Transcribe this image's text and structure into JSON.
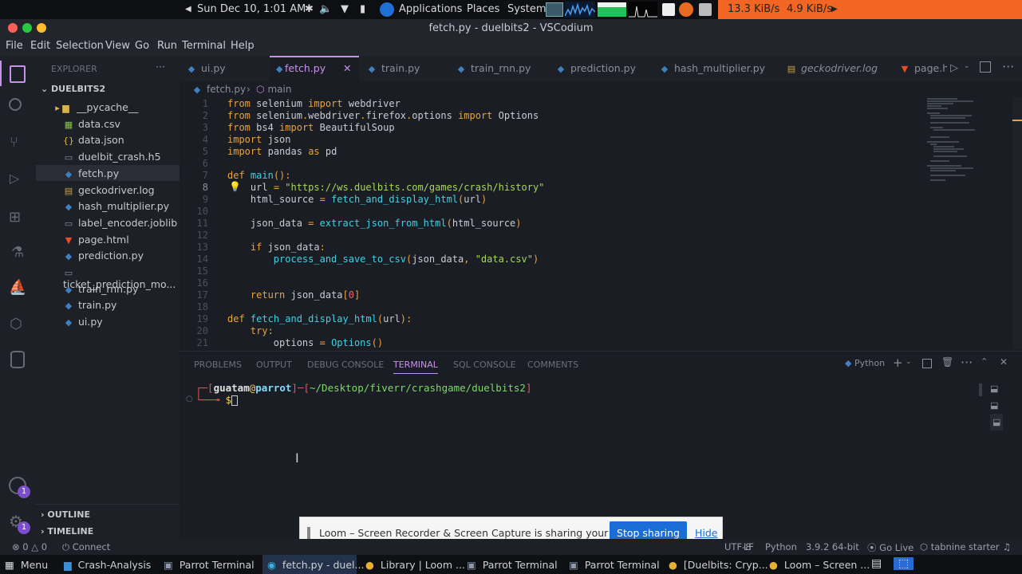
{
  "topbar": {
    "datetime": "Sun Dec 10,  1:01 AM",
    "applications": "Applications",
    "places": "Places",
    "system": "System",
    "net_down": "13.3 KiB/s",
    "net_up": "4.9 KiB/s"
  },
  "window_title": "fetch.py - duelbits2 - VSCodium",
  "menu": [
    "File",
    "Edit",
    "Selection",
    "View",
    "Go",
    "Run",
    "Terminal",
    "Help"
  ],
  "sidebar": {
    "header": "EXPLORER",
    "folder": "DUELBITS2",
    "files": [
      {
        "name": "__pycache__",
        "icon": "folder-icon",
        "color": "#d8b24c"
      },
      {
        "name": "data.csv",
        "icon": "csv-icon",
        "color": "#8bc34a"
      },
      {
        "name": "data.json",
        "icon": "json-icon",
        "color": "#e2b93d"
      },
      {
        "name": "duelbit_crash.h5",
        "icon": "file-icon",
        "color": "#8a8e98"
      },
      {
        "name": "fetch.py",
        "icon": "python-icon",
        "color": "#3f7fbf"
      },
      {
        "name": "geckodriver.log",
        "icon": "log-icon",
        "color": "#c2a33c"
      },
      {
        "name": "hash_multiplier.py",
        "icon": "python-icon",
        "color": "#3f7fbf"
      },
      {
        "name": "label_encoder.joblib",
        "icon": "file-icon",
        "color": "#8a8e98"
      },
      {
        "name": "page.html",
        "icon": "html-icon",
        "color": "#e44d26"
      },
      {
        "name": "prediction.py",
        "icon": "python-icon",
        "color": "#3f7fbf"
      },
      {
        "name": "ticket_prediction_mo...",
        "icon": "file-icon",
        "color": "#8a8e98"
      },
      {
        "name": "train_rnn.py",
        "icon": "python-icon",
        "color": "#3f7fbf"
      },
      {
        "name": "train.py",
        "icon": "python-icon",
        "color": "#3f7fbf"
      },
      {
        "name": "ui.py",
        "icon": "python-icon",
        "color": "#3f7fbf"
      }
    ],
    "outline": "OUTLINE",
    "timeline": "TIMELINE"
  },
  "tabs": [
    "ui.py",
    "fetch.py",
    "train.py",
    "train_rnn.py",
    "prediction.py",
    "hash_multiplier.py",
    "geckodriver.log",
    "page.ht"
  ],
  "breadcrumb": {
    "file": "fetch.py",
    "symbol": "main"
  },
  "code_lines": [
    {
      "n": "1",
      "text": "from selenium import webdriver"
    },
    {
      "n": "2",
      "text": "from selenium.webdriver.firefox.options import Options"
    },
    {
      "n": "3",
      "text": "from bs4 import BeautifulSoup"
    },
    {
      "n": "4",
      "text": "import json"
    },
    {
      "n": "5",
      "text": "import pandas as pd"
    },
    {
      "n": "6",
      "text": ""
    },
    {
      "n": "7",
      "text": "def main():"
    },
    {
      "n": "8",
      "text": "    url = \"https://ws.duelbits.com/games/crash/history\""
    },
    {
      "n": "9",
      "text": "    html_source = fetch_and_display_html(url)"
    },
    {
      "n": "10",
      "text": ""
    },
    {
      "n": "11",
      "text": "    json_data = extract_json_from_html(html_source)"
    },
    {
      "n": "12",
      "text": ""
    },
    {
      "n": "13",
      "text": "    if json_data:"
    },
    {
      "n": "14",
      "text": "        process_and_save_to_csv(json_data, \"data.csv\")"
    },
    {
      "n": "15",
      "text": ""
    },
    {
      "n": "16",
      "text": ""
    },
    {
      "n": "17",
      "text": "    return json_data[0]"
    },
    {
      "n": "18",
      "text": ""
    },
    {
      "n": "19",
      "text": "def fetch_and_display_html(url):"
    },
    {
      "n": "20",
      "text": "    try:"
    },
    {
      "n": "21",
      "text": "        options = Options()"
    }
  ],
  "panel": {
    "tabs": [
      "PROBLEMS",
      "OUTPUT",
      "DEBUG CONSOLE",
      "TERMINAL",
      "SQL CONSOLE",
      "COMMENTS"
    ],
    "shell_label": "Python",
    "prompt_user": "guatam",
    "prompt_host": "parrot",
    "prompt_path": "~/Desktop/fiverr/crashgame/duelbits2",
    "prompt_symbol": "$"
  },
  "loom": {
    "message": "Loom – Screen Recorder & Screen Capture is sharing your screen.",
    "stop": "Stop sharing",
    "hide": "Hide"
  },
  "status": {
    "errors": "0",
    "warnings": "0",
    "connect": "Connect",
    "encoding": "UTF-8",
    "eol": "LF",
    "language": "Python",
    "interpreter": "3.9.2 64-bit",
    "golive": "Go Live",
    "tabnine": "tabnine starter"
  },
  "badges": {
    "account": "1",
    "settings": "1"
  },
  "taskbar": [
    {
      "label": "Menu",
      "icon": "menu-icon"
    },
    {
      "label": "Crash-Analysis",
      "icon": "folder-icon"
    },
    {
      "label": "Parrot Terminal",
      "icon": "terminal-icon"
    },
    {
      "label": "fetch.py - duel...",
      "icon": "vscodium-icon"
    },
    {
      "label": "Library | Loom ...",
      "icon": "chrome-icon"
    },
    {
      "label": "Parrot Terminal",
      "icon": "terminal-icon"
    },
    {
      "label": "Parrot Terminal",
      "icon": "terminal-icon"
    },
    {
      "label": "[Duelbits: Cryp...",
      "icon": "chrome-icon"
    },
    {
      "label": "Loom – Screen ...",
      "icon": "chrome-icon"
    }
  ],
  "colors": {
    "accent": "#c792ea",
    "loom_button": "#1a6dd6",
    "topbar_right": "#f26522"
  }
}
